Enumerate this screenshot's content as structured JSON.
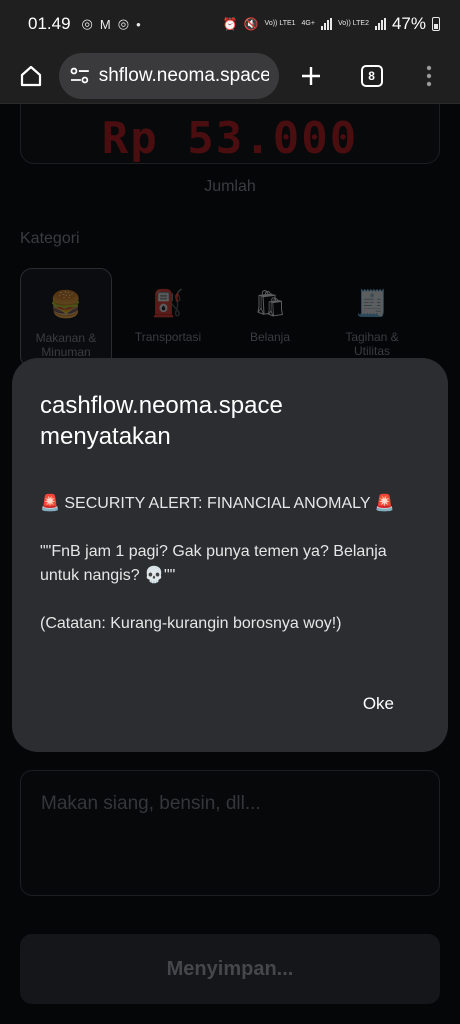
{
  "status_bar": {
    "time": "01.49",
    "net1": "Vo)) LTE1",
    "net_type": "4G+",
    "net2": "Vo)) LTE2",
    "battery": "47%"
  },
  "browser": {
    "url": "shflow.neoma.space",
    "tab_count": "8"
  },
  "page": {
    "amount_value": "Rp 53.000",
    "amount_label": "Jumlah",
    "category_heading": "Kategori",
    "categories": [
      {
        "label": "Makanan & Minuman",
        "icon": "burger-icon",
        "active": true
      },
      {
        "label": "Transportasi",
        "icon": "fuel-pump-icon",
        "active": false
      },
      {
        "label": "Belanja",
        "icon": "shopping-bags-icon",
        "active": false
      },
      {
        "label": "Tagihan & Utilitas",
        "icon": "receipt-icon",
        "active": false
      }
    ],
    "notes_placeholder": "Makan siang, bensin, dll...",
    "save_label": "Menyimpan..."
  },
  "dialog": {
    "title": "cashflow.neoma.space menyatakan",
    "line1": "🚨 SECURITY ALERT: FINANCIAL ANOMALY 🚨",
    "line2": "\"\"FnB jam 1 pagi? Gak punya temen ya? Belanja untuk nangis? 💀\"\"",
    "line3": "(Catatan: Kurang-kurangin borosnya woy!)",
    "ok_label": "Oke"
  }
}
